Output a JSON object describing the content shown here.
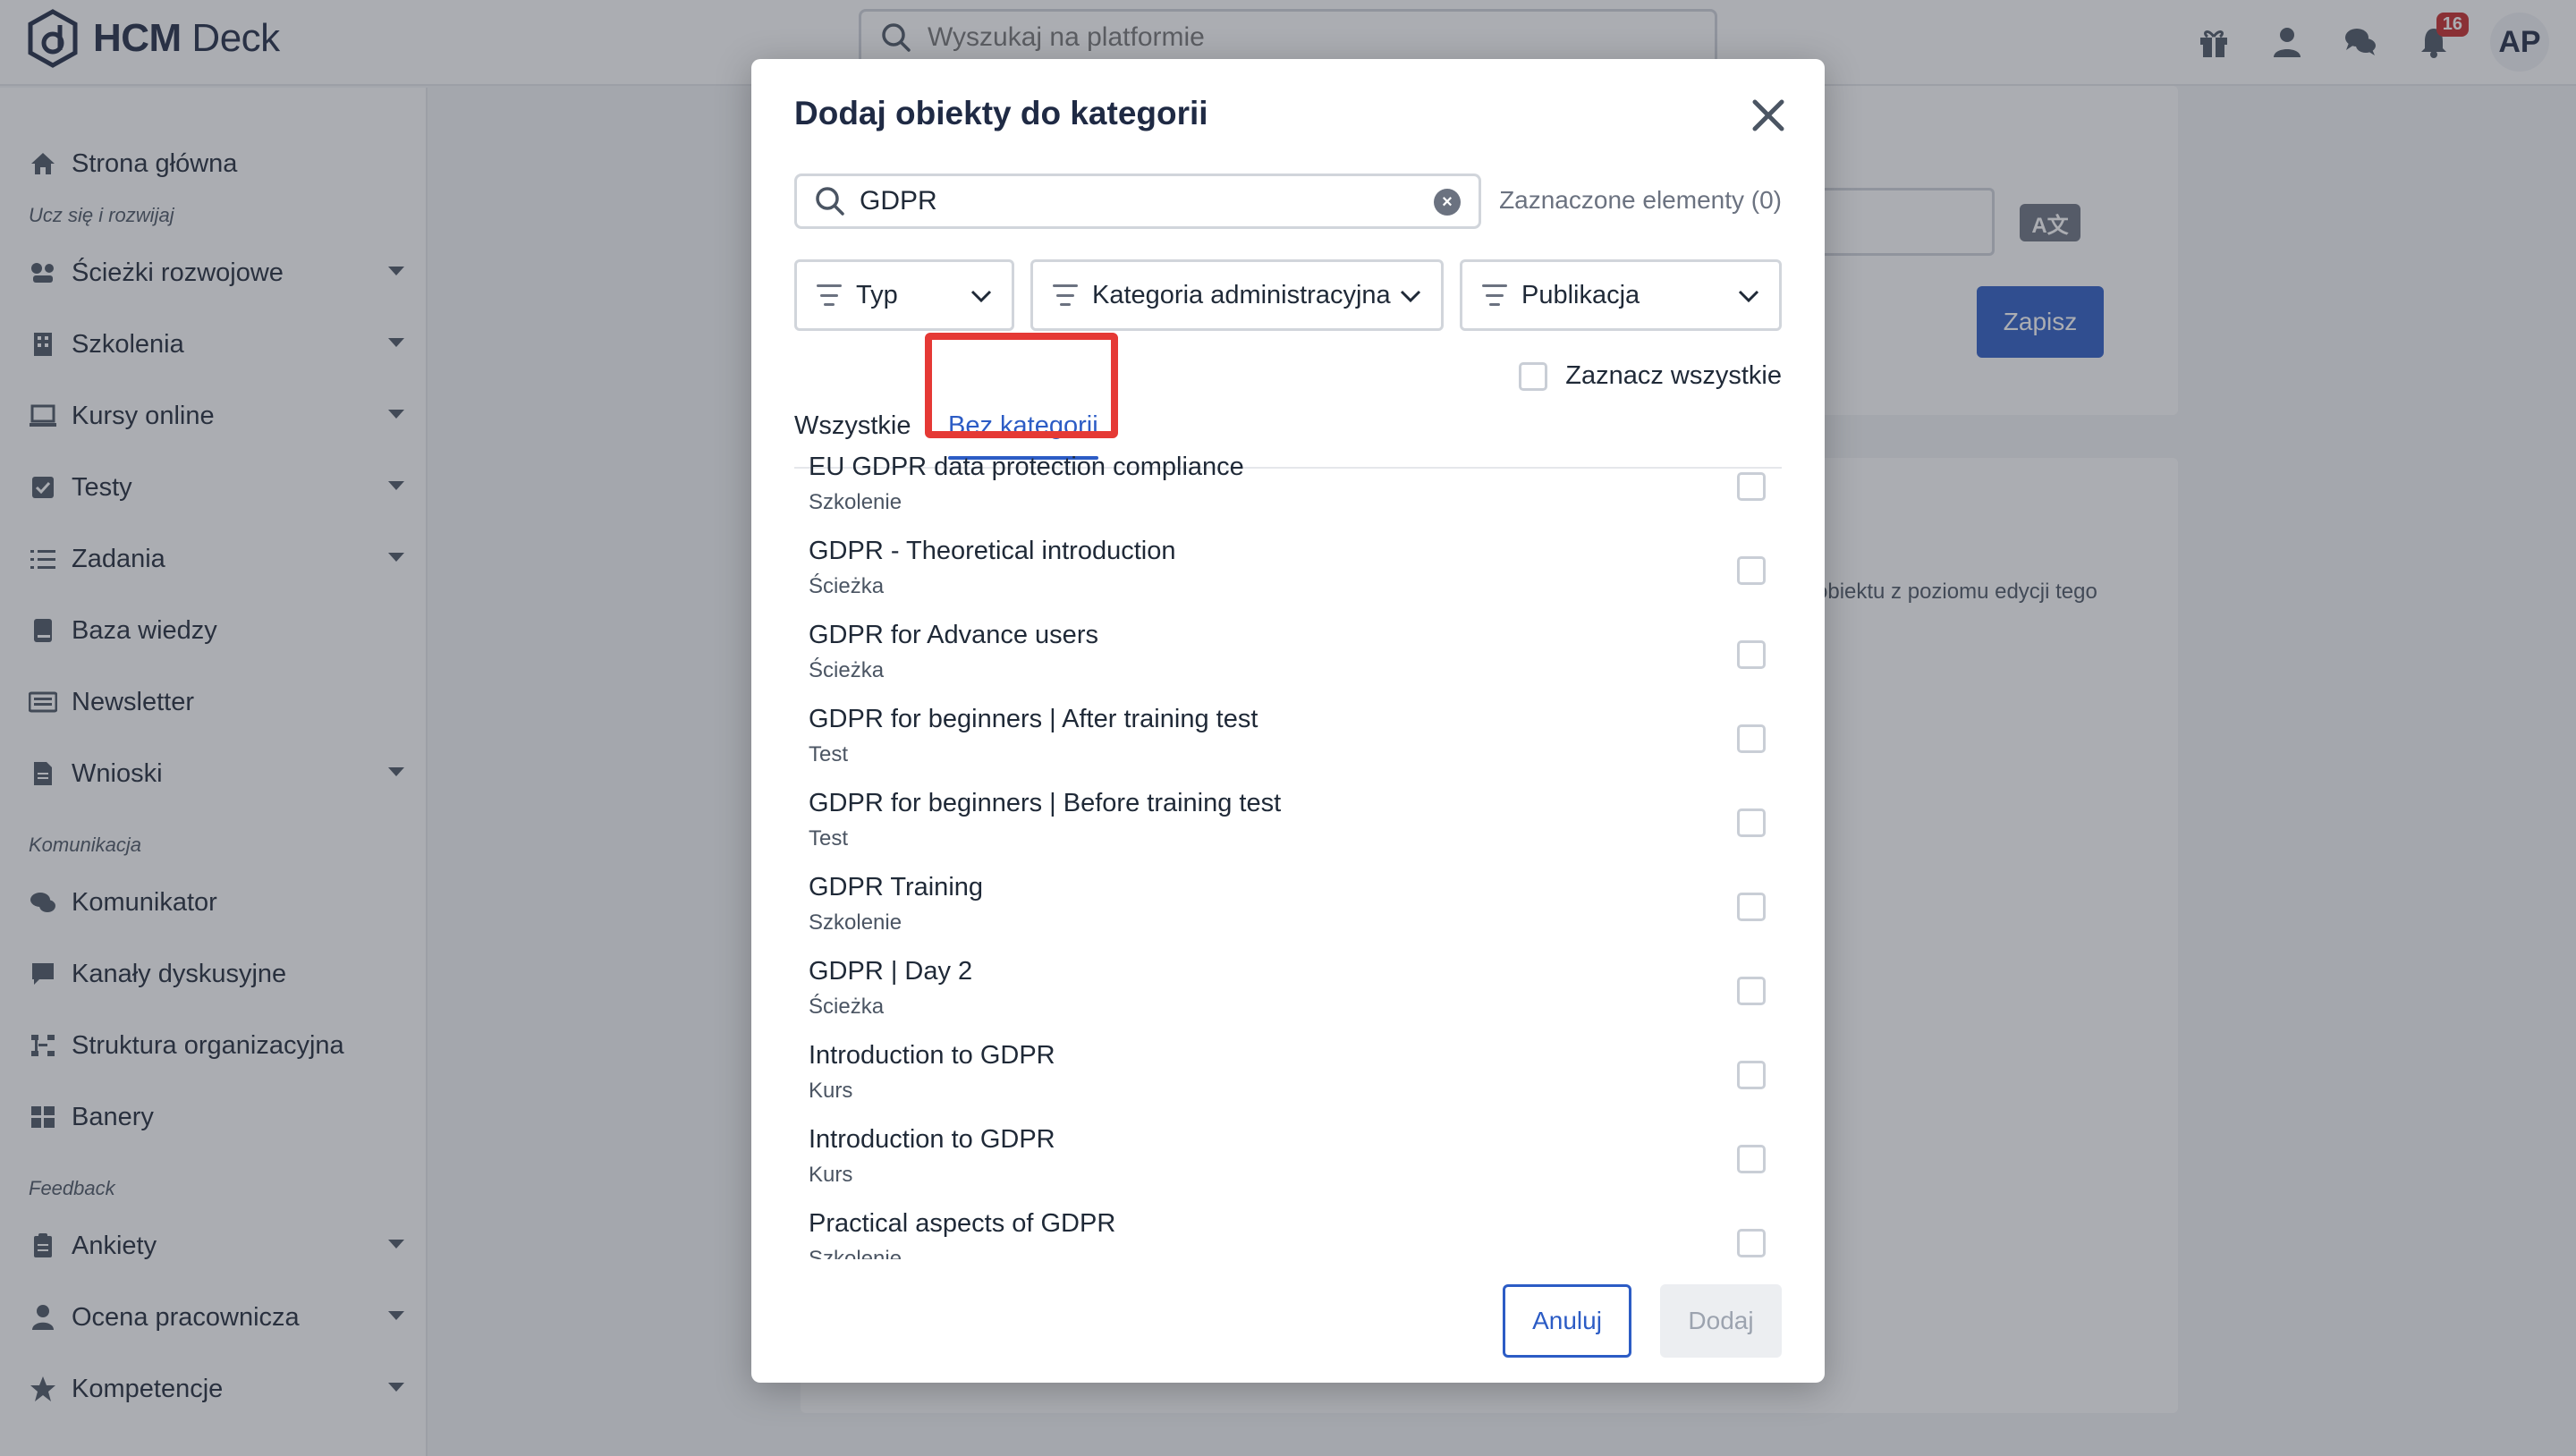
{
  "app": {
    "name_bold": "HCM",
    "name_light": " Deck"
  },
  "search": {
    "placeholder": "Wyszukaj na platformie"
  },
  "notifications": {
    "count": "16"
  },
  "user": {
    "initials": "AP"
  },
  "sidebar": {
    "items": [
      {
        "label": "Strona główna"
      },
      {
        "label": "Ścieżki rozwojowe"
      },
      {
        "label": "Szkolenia"
      },
      {
        "label": "Kursy online"
      },
      {
        "label": "Testy"
      },
      {
        "label": "Zadania"
      },
      {
        "label": "Baza wiedzy"
      },
      {
        "label": "Newsletter"
      },
      {
        "label": "Wnioski"
      },
      {
        "label": "Komunikator"
      },
      {
        "label": "Kanały dyskusyjne"
      },
      {
        "label": "Struktura organizacyjna"
      },
      {
        "label": "Banery"
      },
      {
        "label": "Ankiety"
      },
      {
        "label": "Ocena pracownicza"
      },
      {
        "label": "Kompetencje"
      }
    ],
    "sections": [
      "Ucz się i rozwijaj",
      "Komunikacja",
      "Feedback"
    ]
  },
  "background": {
    "save_label": "Zapisz",
    "translate_label": "A文",
    "hint_text": "obiektu z poziomu edycji tego"
  },
  "modal": {
    "title": "Dodaj obiekty do kategorii",
    "search_value": "GDPR",
    "selected_label": "Zaznaczone elementy (0)",
    "filters": [
      "Typ",
      "Kategoria administracyjna",
      "Publikacja"
    ],
    "tabs": [
      "Wszystkie",
      "Bez kategorii"
    ],
    "select_all_label": "Zaznacz wszystkie",
    "items": [
      {
        "title": "EU GDPR data protection compliance",
        "type": "Szkolenie"
      },
      {
        "title": "GDPR - Theoretical introduction",
        "type": "Ścieżka"
      },
      {
        "title": "GDPR for Advance users",
        "type": "Ścieżka"
      },
      {
        "title": "GDPR for beginners | After training test",
        "type": "Test"
      },
      {
        "title": "GDPR for beginners | Before training test",
        "type": "Test"
      },
      {
        "title": "GDPR Training",
        "type": "Szkolenie"
      },
      {
        "title": "GDPR | Day 2",
        "type": "Ścieżka"
      },
      {
        "title": "Introduction to GDPR",
        "type": "Kurs"
      },
      {
        "title": "Introduction to GDPR",
        "type": "Kurs"
      },
      {
        "title": "Practical aspects of GDPR",
        "type": "Szkolenie"
      }
    ],
    "cancel_label": "Anuluj",
    "add_label": "Dodaj"
  },
  "colors": {
    "accent": "#2c5cc5",
    "highlight": "#e53935",
    "badge": "#c62828"
  }
}
